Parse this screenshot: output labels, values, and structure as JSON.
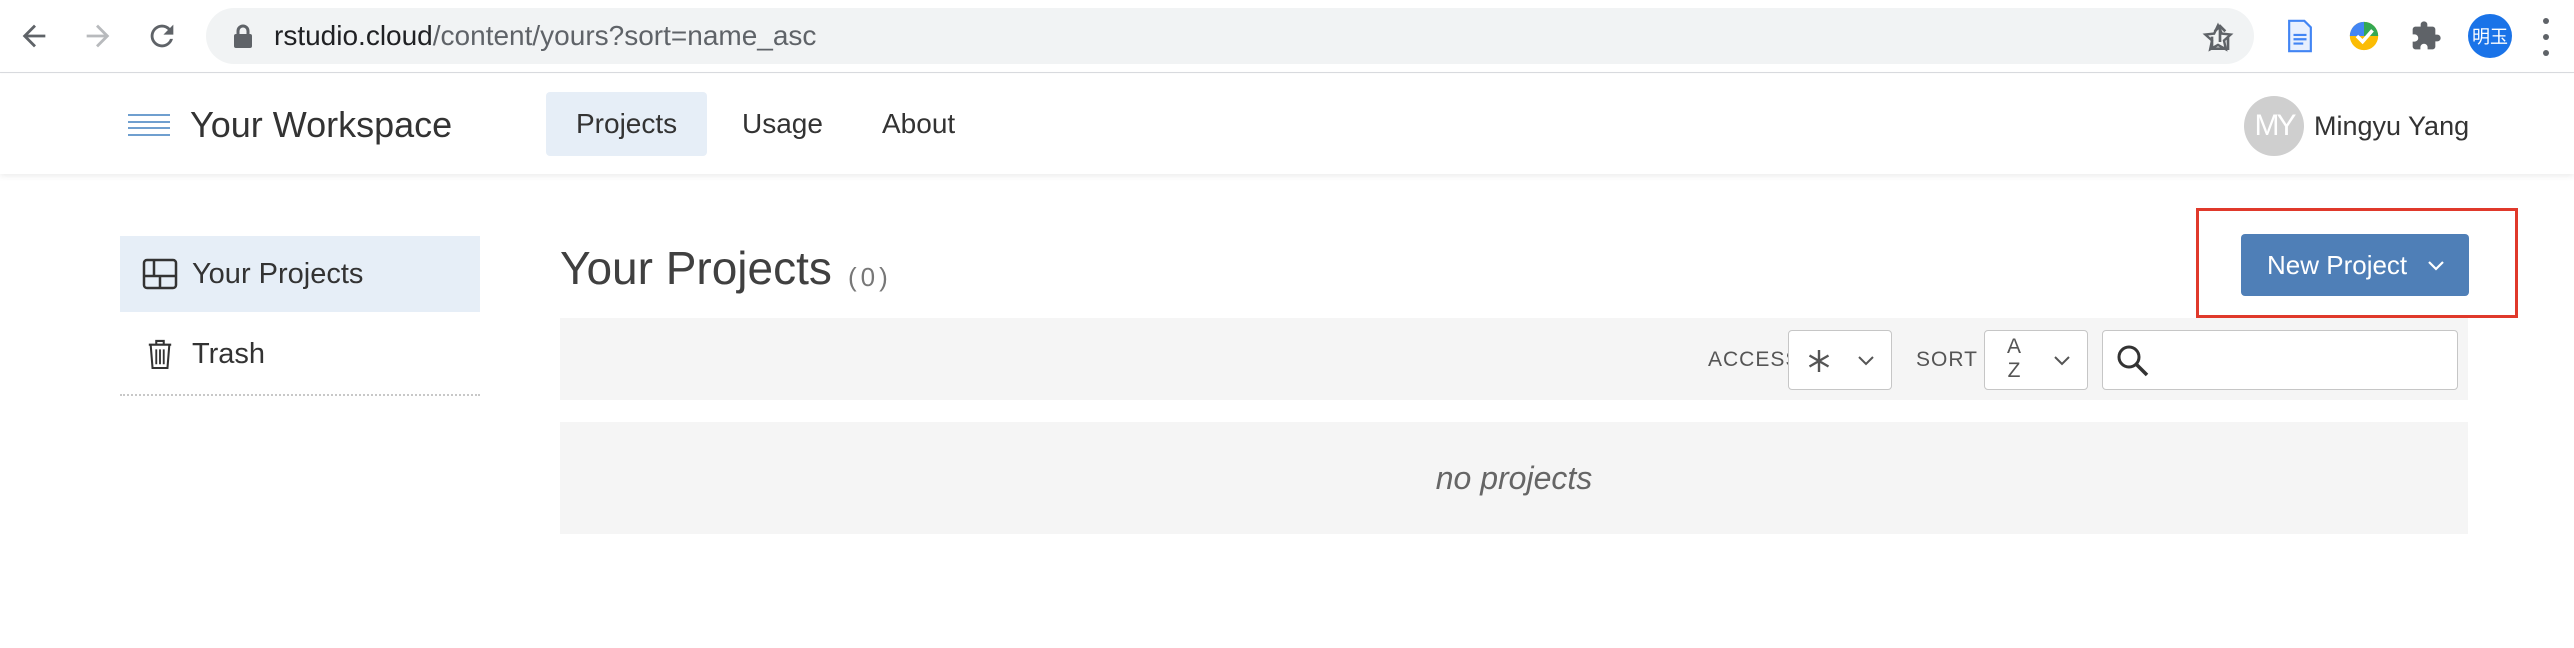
{
  "browser": {
    "url_host": "rstudio.cloud",
    "url_path": "/content/yours?sort=name_asc",
    "profile_initials": "明玉",
    "icons": [
      "back-icon",
      "forward-icon",
      "reload-icon",
      "lock-icon",
      "share-icon",
      "star-icon",
      "doc-extension-icon",
      "color-extension-icon",
      "puzzle-icon",
      "kebab-menu-icon"
    ]
  },
  "header": {
    "workspace_title": "Your Workspace",
    "tabs": [
      {
        "label": "Projects",
        "active": true
      },
      {
        "label": "Usage",
        "active": false
      },
      {
        "label": "About",
        "active": false
      }
    ],
    "avatar_initials": "MY",
    "user_name": "Mingyu Yang"
  },
  "sidebar": {
    "items": [
      {
        "label": "Your Projects",
        "icon": "projects-grid-icon",
        "active": true
      },
      {
        "label": "Trash",
        "icon": "trash-icon",
        "active": false
      }
    ]
  },
  "main": {
    "title": "Your Projects",
    "count": "(0)",
    "new_project_label": "New Project",
    "access_label": "ACCESS",
    "access_value_icon": "asterisk-icon",
    "sort_label": "SORT",
    "sort_value_icon": "sort-az-icon",
    "sort_top": "A",
    "sort_bottom": "Z",
    "search_placeholder": "",
    "empty_text": "no projects"
  },
  "colors": {
    "accent": "#4f7fb7",
    "highlight": "#e0392b",
    "active_bg": "#e6eef7"
  }
}
